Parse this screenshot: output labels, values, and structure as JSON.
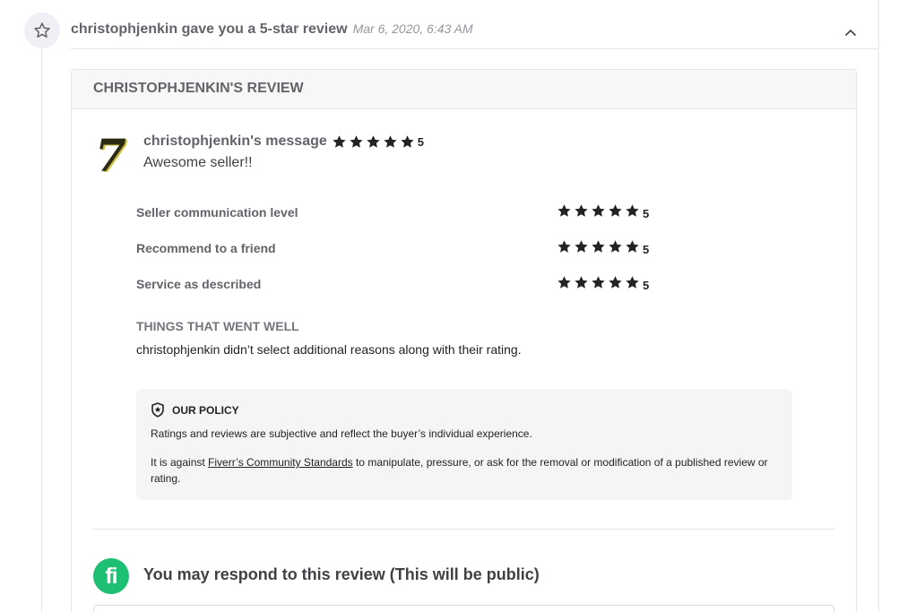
{
  "event": {
    "icon": "star-outline-icon",
    "title": "christophjenkin gave you a 5-star review",
    "date": "Mar 6, 2020, 6:43 AM",
    "collapse_icon": "chevron-up-icon"
  },
  "review": {
    "header": "CHRISTOPHJENKIN'S REVIEW",
    "avatar_text": "7",
    "message_author": "christophjenkin's message",
    "message_rating": "5",
    "message_text": "Awesome seller!!",
    "ratings": [
      {
        "label": "Seller communication level",
        "value": "5"
      },
      {
        "label": "Recommend to a friend",
        "value": "5"
      },
      {
        "label": "Service as described",
        "value": "5"
      }
    ],
    "went_well_title": "THINGS THAT WENT WELL",
    "went_well_text": "christophjenkin didn’t select additional reasons along with their rating."
  },
  "policy": {
    "icon": "shield-star-icon",
    "title": "OUR POLICY",
    "p1": "Ratings and reviews are subjective and reflect the buyer’s individual experience.",
    "p2_before": "It is against ",
    "p2_link": "Fiverr’s Community Standards",
    "p2_after": " to manipulate, pressure, or ask for the removal or modification of a published review or rating."
  },
  "respond": {
    "logo_text": "fi",
    "title": "You may respond to this review (This will be public)"
  },
  "colors": {
    "star": "#222325",
    "brand_green": "#1dbf73"
  }
}
